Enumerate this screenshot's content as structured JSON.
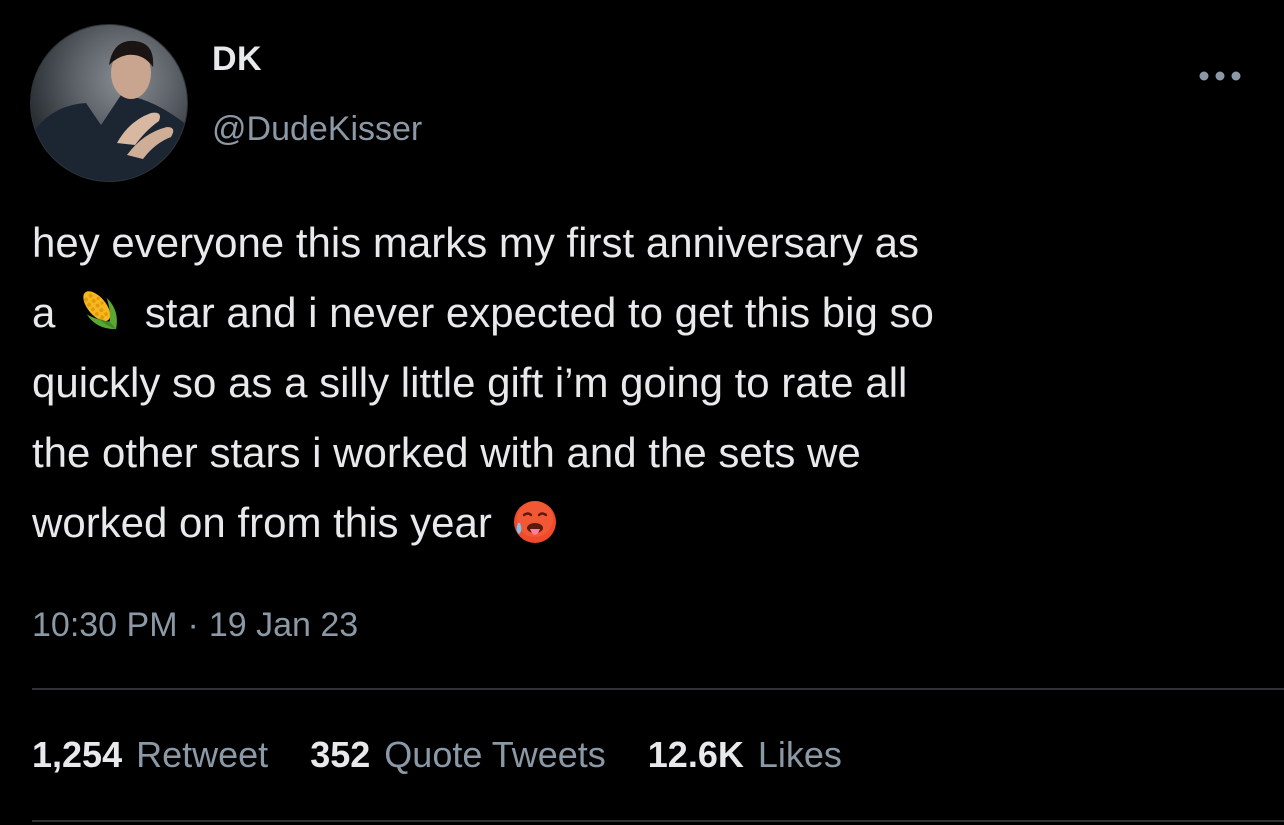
{
  "author": {
    "display_name": "DK",
    "handle": "@DudeKisser"
  },
  "tweet": {
    "lines": [
      {
        "before": "hey everyone this marks my first anniversary as",
        "emoji": "",
        "after": ""
      },
      {
        "before": "a",
        "emoji": "corn-emoji",
        "after": "star and i never expected to get this big so"
      },
      {
        "before": "quickly so as a silly little gift i’m going to rate all",
        "emoji": "",
        "after": ""
      },
      {
        "before": "the other stars i worked with and the sets we",
        "emoji": "",
        "after": ""
      },
      {
        "before": "worked on from this year",
        "emoji": "hot-face-emoji",
        "after": ""
      }
    ],
    "time": "10:30 PM",
    "separator": "·",
    "date": "19 Jan 23"
  },
  "stats": {
    "retweets": {
      "count": "1,254",
      "label": "Retweet"
    },
    "quotes": {
      "count": "352",
      "label": "Quote Tweets"
    },
    "likes": {
      "count": "12.6K",
      "label": "Likes"
    }
  },
  "icons": {
    "more": "more-horizontal-icon"
  },
  "colors": {
    "background": "#000000",
    "primary_text": "#e7e9ea",
    "secondary_text": "#8b98a5",
    "divider": "#2f3336"
  }
}
